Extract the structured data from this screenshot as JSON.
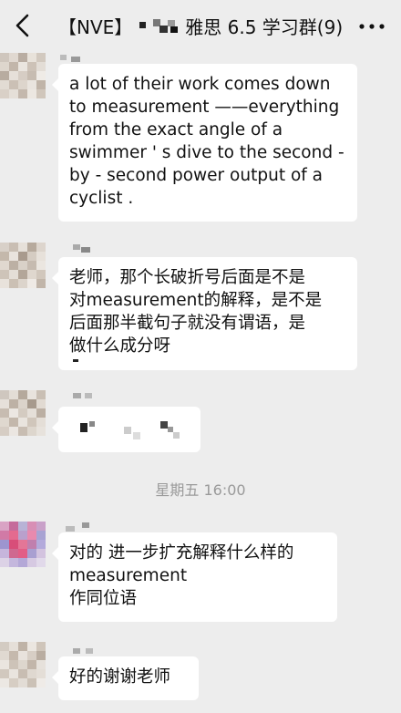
{
  "header": {
    "title_prefix": "【NVE】",
    "title_suffix": "雅思 6.5 学习群(9)",
    "back_icon": "chevron-left-icon",
    "more_icon": "more-dots-icon"
  },
  "messages": [
    {
      "lines": [
        "a lot of their work comes down",
        "to measurement ——everything",
        "from the exact angle of a",
        "swimmer ' s dive to the second -",
        " by - second power output of a",
        "cyclist ."
      ]
    },
    {
      "lines": [
        "老师，那个长破折号后面是不是",
        "对measurement的解释，是不是",
        "后面那半截句子就没有谓语，是",
        "做什么成分呀"
      ]
    },
    {
      "lines": []
    },
    {
      "lines": [
        "对的 进一步扩充解释什么样的",
        "measurement",
        "作同位语"
      ]
    },
    {
      "lines": [
        "好的谢谢老师"
      ]
    }
  ],
  "timestamp": "星期五 16:00",
  "colors": {
    "background": "#ededed",
    "bubble": "#ffffff",
    "timestamp": "#9a9a9a"
  }
}
